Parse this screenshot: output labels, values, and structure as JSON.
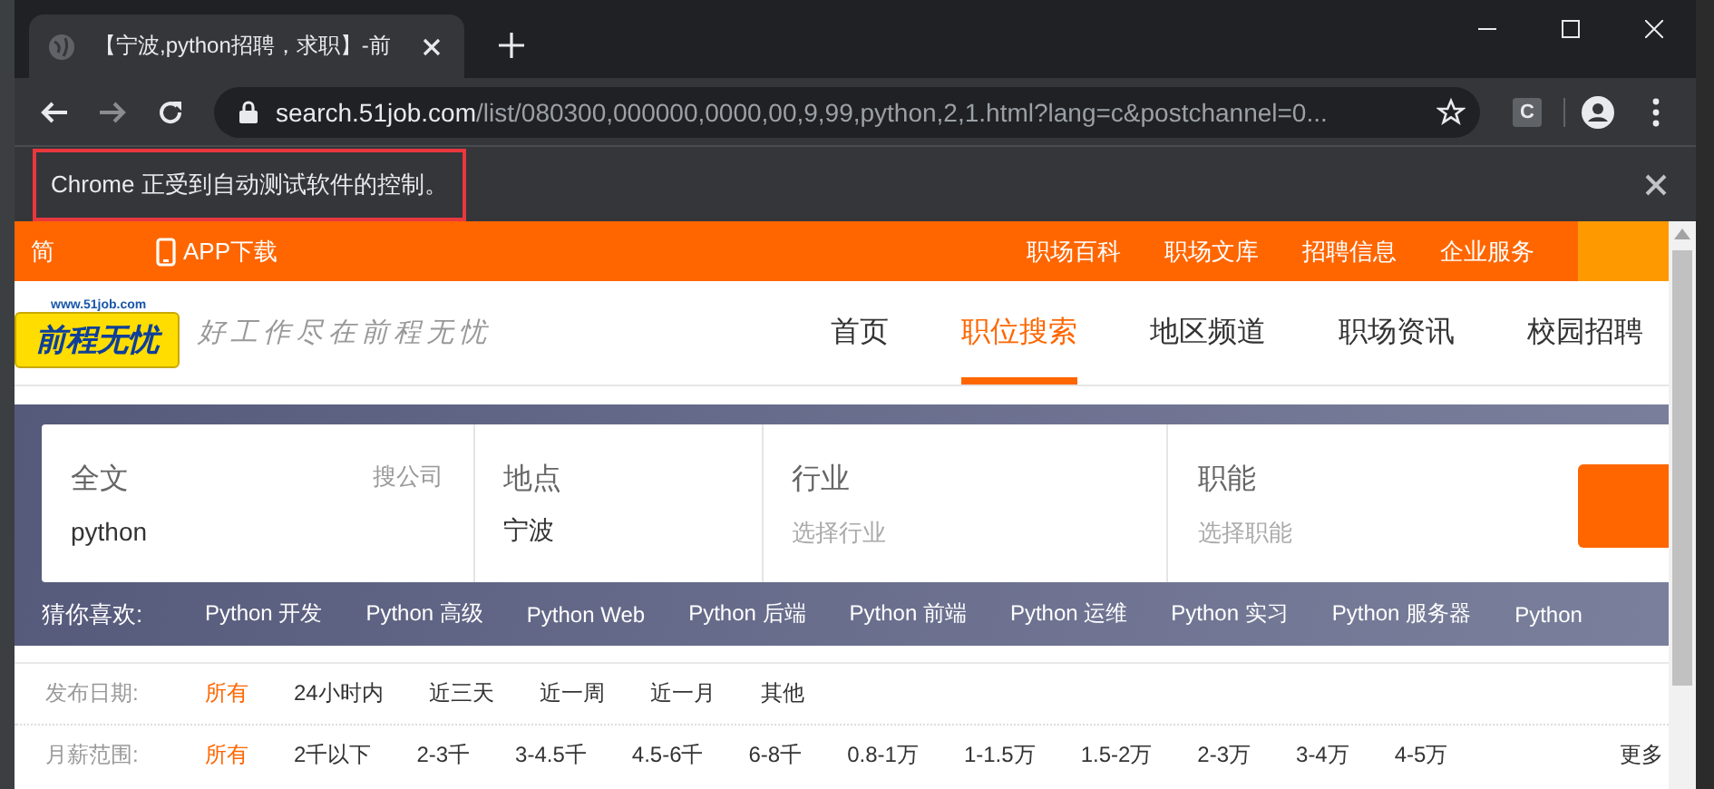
{
  "browser": {
    "tab": {
      "title": "【宁波,python招聘，求职】-前"
    },
    "address": {
      "host": "search.51job.com",
      "path": "/list/080300,000000,0000,00,9,99,python,2,1.html?lang=c&postchannel=0..."
    },
    "extension_label": "C",
    "infobar": {
      "message": "Chrome 正受到自动测试软件的控制。",
      "highlighted": true
    }
  },
  "page": {
    "top_bar": {
      "left": [
        {
          "label": "简",
          "kind": "text"
        },
        {
          "label": "APP下载",
          "kind": "app"
        }
      ],
      "right": [
        "职场百科",
        "职场文库",
        "招聘信息",
        "企业服务"
      ]
    },
    "header": {
      "logo": {
        "url": "www.51job.com",
        "name": "前程无忧"
      },
      "slogan": "好工作尽在前程无忧",
      "nav": [
        {
          "label": "首页",
          "selected": false
        },
        {
          "label": "职位搜索",
          "selected": true
        },
        {
          "label": "地区频道",
          "selected": false
        },
        {
          "label": "职场资讯",
          "selected": false
        },
        {
          "label": "校园招聘",
          "selected": false
        }
      ]
    },
    "search": {
      "fields": [
        {
          "label": "全文",
          "aside": "搜公司",
          "value": "python"
        },
        {
          "label": "地点",
          "value": "宁波"
        },
        {
          "label": "行业",
          "placeholder": "选择行业"
        },
        {
          "label": "职能",
          "placeholder": "选择职能"
        }
      ]
    },
    "suggestions": {
      "label": "猜你喜欢:",
      "items": [
        "Python 开发",
        "Python 高级",
        "Python Web",
        "Python 后端",
        "Python 前端",
        "Python 运维",
        "Python 实习",
        "Python 服务器",
        "Python"
      ]
    },
    "filters": [
      {
        "label": "发布日期:",
        "options": [
          {
            "label": "所有",
            "selected": true
          },
          {
            "label": "24小时内",
            "selected": false
          },
          {
            "label": "近三天",
            "selected": false
          },
          {
            "label": "近一周",
            "selected": false
          },
          {
            "label": "近一月",
            "selected": false
          },
          {
            "label": "其他",
            "selected": false
          }
        ]
      },
      {
        "label": "月薪范围:",
        "more": "更多",
        "options": [
          {
            "label": "所有",
            "selected": true
          },
          {
            "label": "2千以下",
            "selected": false
          },
          {
            "label": "2-3千",
            "selected": false
          },
          {
            "label": "3-4.5千",
            "selected": false
          },
          {
            "label": "4.5-6千",
            "selected": false
          },
          {
            "label": "6-8千",
            "selected": false
          },
          {
            "label": "0.8-1万",
            "selected": false
          },
          {
            "label": "1-1.5万",
            "selected": false
          },
          {
            "label": "1.5-2万",
            "selected": false
          },
          {
            "label": "2-3万",
            "selected": false
          },
          {
            "label": "3-4万",
            "selected": false
          },
          {
            "label": "4-5万",
            "selected": false
          }
        ]
      }
    ]
  }
}
